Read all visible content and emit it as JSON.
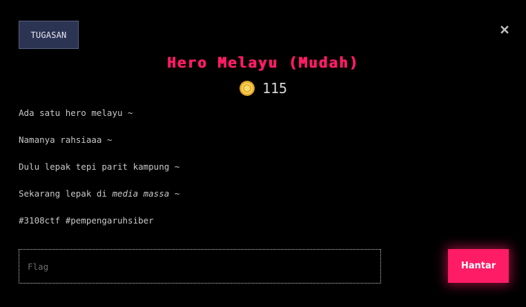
{
  "tab": {
    "label": "TUGASAN"
  },
  "challenge": {
    "title": "Hero Melayu (Mudah)",
    "points": "115",
    "description": {
      "line1": "Ada satu hero melayu ~",
      "line2": "Namanya rahsiaaa ~",
      "line3": "Dulu lepak tepi parit kampung ~",
      "line4_prefix": "Sekarang lepak di ",
      "line4_emphasis": "media massa",
      "line4_suffix": " ~",
      "line5": "#3108ctf #pempengaruhsiber"
    }
  },
  "form": {
    "flag_placeholder": "Flag",
    "flag_value": "",
    "submit_label": "Hantar"
  },
  "icons": {
    "close": "close-icon",
    "coin": "coin-icon"
  },
  "colors": {
    "accent": "#ff1c66",
    "tab_background": "#2c3454",
    "background": "#000000",
    "coin": "#f2c94c"
  }
}
